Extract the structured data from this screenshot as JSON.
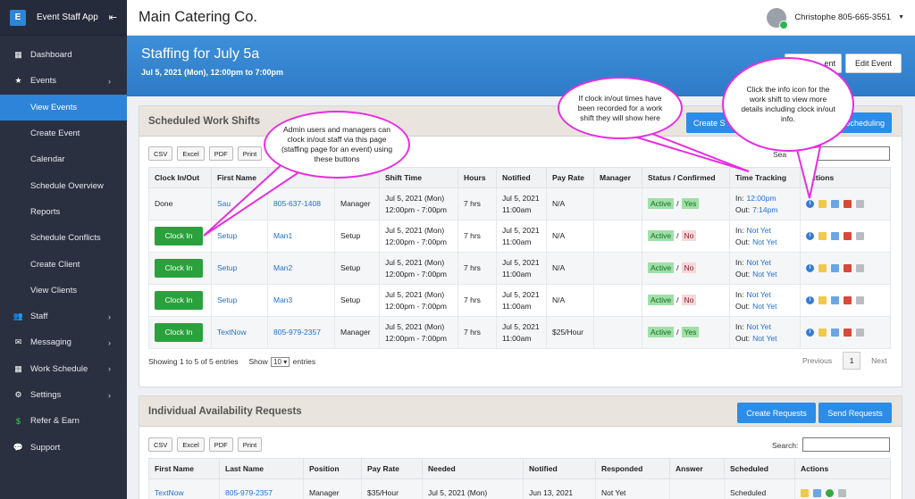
{
  "sidebar": {
    "brand_logo": "E",
    "brand_name": "Event Staff App",
    "collapse_icon": "collapse-icon",
    "items": [
      {
        "label": "Dashboard",
        "icon": "grid-icon"
      },
      {
        "label": "Events",
        "icon": "star-icon",
        "chevron": "›"
      },
      {
        "label": "View Events",
        "active": true
      },
      {
        "label": "Create Event"
      },
      {
        "label": "Calendar"
      },
      {
        "label": "Schedule Overview"
      },
      {
        "label": "Reports"
      },
      {
        "label": "Schedule Conflicts"
      },
      {
        "label": "Create Client"
      },
      {
        "label": "View Clients"
      },
      {
        "label": "Staff",
        "icon": "users-icon",
        "chevron": "›"
      },
      {
        "label": "Messaging",
        "icon": "envelope-icon",
        "chevron": "›"
      },
      {
        "label": "Work Schedule",
        "icon": "calendar-icon",
        "chevron": "›"
      },
      {
        "label": "Settings",
        "icon": "gear-icon",
        "chevron": "›"
      },
      {
        "label": "Refer & Earn",
        "icon": "dollar-icon"
      },
      {
        "label": "Support",
        "icon": "chat-icon"
      }
    ]
  },
  "topbar": {
    "company": "Main Catering Co.",
    "user": "Christophe 805-665-3551"
  },
  "banner": {
    "title": "Staffing for July 5a",
    "subtitle": "Jul 5, 2021 (Mon), 12:00pm to 7:00pm",
    "btn_partial": "ent",
    "btn_edit": "Edit Event"
  },
  "shifts": {
    "title": "Scheduled Work Shifts",
    "btn_create_partial": "Create S",
    "btn_scheduling_partial": "Scheduling",
    "export": [
      "CSV",
      "Excel",
      "PDF",
      "Print"
    ],
    "search_label": "Sea",
    "columns": [
      "Clock In/Out",
      "First Name",
      "",
      "",
      "Shift Time",
      "Hours",
      "Notified",
      "Pay Rate",
      "Manager",
      "Status / Confirmed",
      "Time Tracking",
      "Actions"
    ],
    "rows": [
      {
        "clock": "Done",
        "first": "Sau",
        "last": "805-637-1408",
        "position": "Manager",
        "shift1": "Jul 5, 2021 (Mon)",
        "shift2": "12:00pm - 7:00pm",
        "hours": "7 hrs",
        "not1": "Jul 5, 2021",
        "not2": "11:00am",
        "pay": "N/A",
        "manager": "",
        "status": "Active",
        "confirmed": "Yes",
        "in": "12:00pm",
        "out": "7:14pm"
      },
      {
        "clock": "Clock In",
        "first": "Setup",
        "last": "Man1",
        "position": "Setup",
        "shift1": "Jul 5, 2021 (Mon)",
        "shift2": "12:00pm - 7:00pm",
        "hours": "7 hrs",
        "not1": "Jul 5, 2021",
        "not2": "11:00am",
        "pay": "N/A",
        "manager": "",
        "status": "Active",
        "confirmed": "No",
        "in": "Not Yet",
        "out": "Not Yet"
      },
      {
        "clock": "Clock In",
        "first": "Setup",
        "last": "Man2",
        "position": "Setup",
        "shift1": "Jul 5, 2021 (Mon)",
        "shift2": "12:00pm - 7:00pm",
        "hours": "7 hrs",
        "not1": "Jul 5, 2021",
        "not2": "11:00am",
        "pay": "N/A",
        "manager": "",
        "status": "Active",
        "confirmed": "No",
        "in": "Not Yet",
        "out": "Not Yet"
      },
      {
        "clock": "Clock In",
        "first": "Setup",
        "last": "Man3",
        "position": "Setup",
        "shift1": "Jul 5, 2021 (Mon)",
        "shift2": "12:00pm - 7:00pm",
        "hours": "7 hrs",
        "not1": "Jul 5, 2021",
        "not2": "11:00am",
        "pay": "N/A",
        "manager": "",
        "status": "Active",
        "confirmed": "No",
        "in": "Not Yet",
        "out": "Not Yet"
      },
      {
        "clock": "Clock In",
        "first": "TextNow",
        "last": "805-979-2357",
        "position": "Manager",
        "shift1": "Jul 5, 2021 (Mon)",
        "shift2": "12:00pm - 7:00pm",
        "hours": "7 hrs",
        "not1": "Jul 5, 2021",
        "not2": "11:00am",
        "pay": "$25/Hour",
        "manager": "",
        "status": "Active",
        "confirmed": "Yes",
        "in": "Not Yet",
        "out": "Not Yet"
      }
    ],
    "in_label": "In:",
    "out_label": "Out:",
    "slash": "/",
    "footer_showing": "Showing 1 to 5 of 5 entries",
    "footer_show": "Show",
    "footer_select": "10",
    "footer_entries": "entries",
    "prev": "Previous",
    "page": "1",
    "next": "Next"
  },
  "avail": {
    "title": "Individual Availability Requests",
    "btn_create": "Create Requests",
    "btn_send": "Send Requests",
    "export": [
      "CSV",
      "Excel",
      "PDF",
      "Print"
    ],
    "search_label": "Search:",
    "columns": [
      "First Name",
      "Last Name",
      "Position",
      "Pay Rate",
      "Needed",
      "Notified",
      "Responded",
      "Answer",
      "Scheduled",
      "Actions"
    ],
    "row": {
      "first": "TextNow",
      "last": "805-979-2357",
      "position": "Manager",
      "pay": "$35/Hour",
      "needed": "Jul 5, 2021 (Mon)",
      "notified": "Jun 13, 2021",
      "responded": "Not Yet",
      "answer": "",
      "scheduled": "Scheduled"
    }
  },
  "callouts": {
    "c1": "Admin users and managers can clock in/out staff via this page (staffing page for an event) using these buttons",
    "c2": "If clock in/out times have been recorded for a work shift they will show here",
    "c3": "Click the info icon for the work shift to view more details including clock in/out info."
  },
  "colors": {
    "accent": "#2d84d9",
    "callout": "#e62ee1",
    "clock_btn": "#2aa13c"
  }
}
